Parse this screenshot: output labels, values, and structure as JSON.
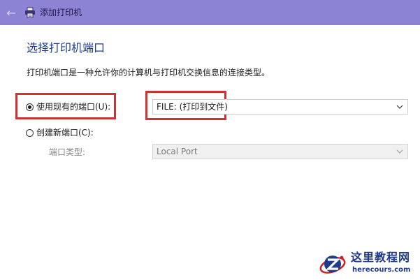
{
  "window": {
    "title": "添加打印机",
    "back_icon": "arrow-left-icon",
    "app_icon": "printer-icon",
    "title_bar_color": "#8d83d4"
  },
  "main": {
    "heading": "选择打印机端口",
    "description": "打印机端口是一种允许你的计算机与打印机交换信息的连接类型。",
    "use_existing": {
      "label": "使用现有的端口(U):",
      "checked": true,
      "selected_value": "FILE: (打印到文件)"
    },
    "create_new": {
      "label": "创建新端口(C):",
      "checked": false,
      "port_type_label": "端口类型:",
      "port_type_value": "Local Port"
    },
    "highlight_color": "#cc3333"
  },
  "watermark": {
    "name": "这里教程网",
    "url": "herecours.com"
  }
}
